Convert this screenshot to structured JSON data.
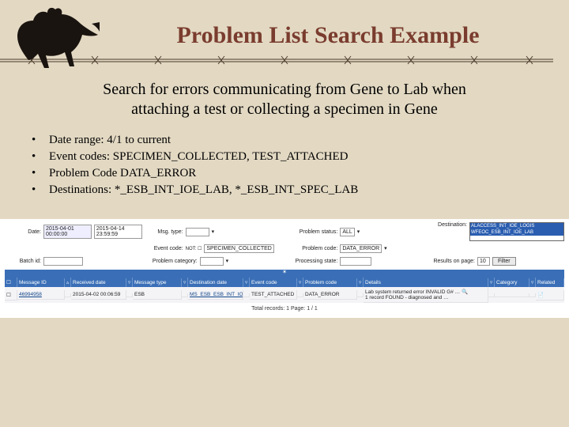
{
  "slide": {
    "title": "Problem List Search Example",
    "subtitle_line1": "Search for errors communicating from Gene to Lab when",
    "subtitle_line2": "attaching a test or collecting a specimen in Gene",
    "bullets": [
      "Date range:  4/1 to current",
      "Event codes:  SPECIMEN_COLLECTED, TEST_ATTACHED",
      "Problem Code DATA_ERROR",
      "Destinations:  *_ESB_INT_IOE_LAB, *_ESB_INT_SPEC_LAB"
    ]
  },
  "filters": {
    "date_label": "Date:",
    "date_from": "2015-04-01 00:00:00",
    "date_to": "2015-04-14 23:59:59",
    "msgtype_label": "Msg. type:",
    "eventcode_label": "Event code:",
    "eventcode_value": "SPECIMEN_COLLECTED",
    "batchid_label": "Batch id:",
    "problemstatus_label": "Problem status:",
    "problemstatus_value": "ALL",
    "problemcategory_label": "Problem category:",
    "problemcode_label": "Problem code:",
    "problemcode_value": "DATA_ERROR",
    "processingstate_label": "Processing state:",
    "destination_label": "Destination:",
    "dest_opt1": "ALACCESS_INT_IOE_LOGIS",
    "dest_opt2": "WFEOC_ESB_INT_IOE_LAB",
    "results_label": "Results on page:",
    "results_value": "10",
    "filter_button": "Filter"
  },
  "table": {
    "headers": {
      "msgid": "Message ID",
      "received": "Received date",
      "msgtype": "Message type",
      "destdate": "Destination date",
      "eventcode": "Event code",
      "problemcode": "Problem code",
      "details": "Details",
      "category": "Category",
      "related": "Related"
    },
    "row": {
      "msgid": "46994958",
      "received": "2015-04-02 00:06:59",
      "msgtype": "ESB",
      "destdate": "MS_ESB_ESB_INT_IOE_LAB",
      "eventcode": "TEST_ATTACHED",
      "problemcode": "DATA_ERROR",
      "details": "Lab system returned error INVALID G# …",
      "details2": "1 record FOUND - diagnosed and …"
    },
    "pager": "Total records: 1   Page: 1 / 1"
  }
}
